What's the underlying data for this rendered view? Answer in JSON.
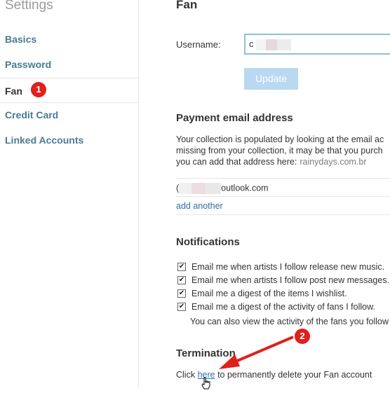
{
  "sidebar": {
    "title": "Settings",
    "items": [
      {
        "label": "Basics"
      },
      {
        "label": "Password"
      },
      {
        "label": "Fan"
      },
      {
        "label": "Credit Card"
      },
      {
        "label": "Linked Accounts"
      }
    ],
    "badge": "1"
  },
  "main": {
    "title": "Fan",
    "username_label": "Username:",
    "username_value": "c",
    "update_label": "Update",
    "payment": {
      "title": "Payment email address",
      "lines": [
        "Your collection is populated by looking at the email ac",
        "missing from your collection, it may be that you purch",
        "you can add that address here:"
      ],
      "watermark": "rainydays.com.br",
      "email_prefix": "(",
      "email_suffix": "outlook.com",
      "add_another": "add another"
    },
    "notifications": {
      "title": "Notifications",
      "items": [
        {
          "label": "Email me when artists I follow release new music."
        },
        {
          "label": "Email me when artists I follow post new messages."
        },
        {
          "label": "Email me a digest of the items I wishlist."
        },
        {
          "label": "Email me a digest of the activity of fans I follow."
        }
      ],
      "activity_text": "You can also view the activity of the fans you follow via"
    },
    "termination": {
      "title": "Termination",
      "text_before": "Click ",
      "link": "here",
      "text_after": " to permanently delete your Fan account"
    },
    "badge": "2"
  },
  "icons": {
    "checkbox": "✔",
    "cursor": "hand-pointer"
  },
  "colors": {
    "link": "#2e6fa8",
    "sidebar_link": "#4a7b93",
    "badge": "#e0201b",
    "button": "#b8d9ef",
    "input_border": "#8cc0de"
  }
}
